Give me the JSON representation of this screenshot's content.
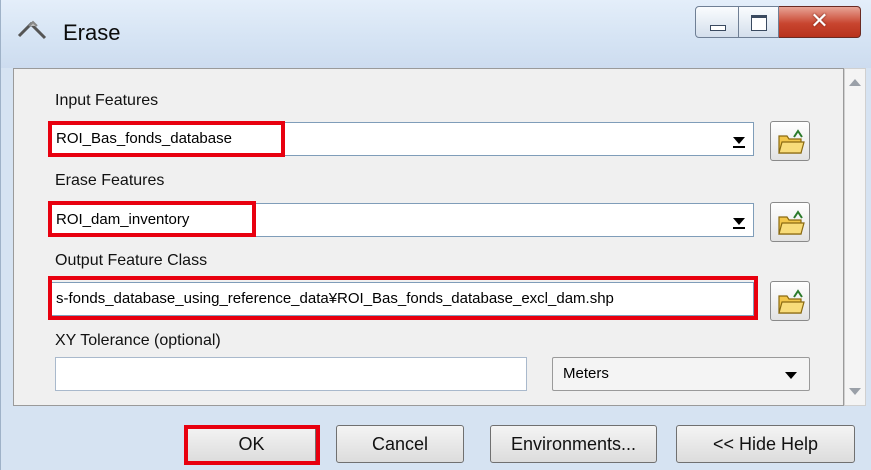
{
  "window": {
    "title": "Erase",
    "icon": "erase-tool-icon",
    "buttons": {
      "minimize": "minimize-icon",
      "maximize": "maximize-icon",
      "close": "✕"
    }
  },
  "form": {
    "input_features": {
      "label": "Input Features",
      "value": "ROI_Bas_fonds_database"
    },
    "erase_features": {
      "label": "Erase Features",
      "value": "ROI_dam_inventory"
    },
    "output_feature_class": {
      "label": "Output Feature Class",
      "value": "s-fonds_database_using_reference_data¥ROI_Bas_fonds_database_excl_dam.shp"
    },
    "xy_tolerance": {
      "label": "XY Tolerance (optional)",
      "value": "",
      "units": "Meters"
    }
  },
  "footer": {
    "ok": "OK",
    "cancel": "Cancel",
    "environments": "Environments...",
    "hide_help": "<< Hide Help"
  },
  "colors": {
    "highlight": "#e8000f",
    "titlebar": "#d6e3f2",
    "close": "#c8452f"
  }
}
